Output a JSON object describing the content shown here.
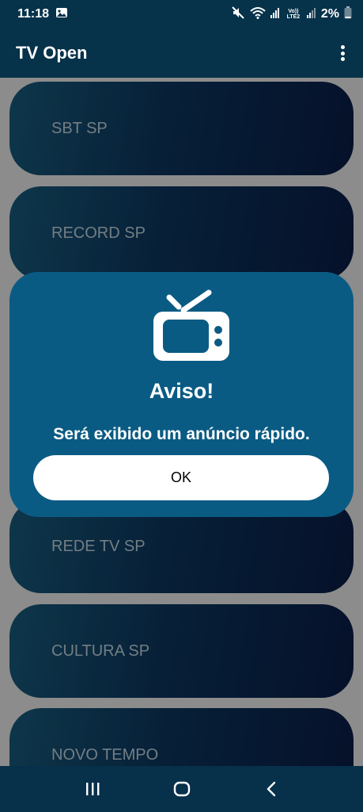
{
  "status_bar": {
    "time": "11:18",
    "lte_label": "Vo)) LTE2",
    "battery_percent": "2%"
  },
  "app_bar": {
    "title": "TV Open"
  },
  "channels": [
    {
      "label": "SBT SP"
    },
    {
      "label": "RECORD SP"
    },
    {
      "label": ""
    },
    {
      "label": ""
    },
    {
      "label": "REDE TV SP"
    },
    {
      "label": "CULTURA SP"
    },
    {
      "label": "NOVO TEMPO"
    }
  ],
  "dialog": {
    "title": "Aviso!",
    "message": "Será exibido um anúncio rápido.",
    "ok_label": "OK"
  },
  "colors": {
    "app_bar": "#06324a",
    "dialog": "#0a5b83",
    "channel_gradient_start": "#1a6488",
    "channel_gradient_end": "#0a1f4c"
  },
  "icons": [
    "gallery-icon",
    "mute-icon",
    "wifi-icon",
    "signal-icon",
    "battery-icon",
    "more-vert-icon",
    "tv-icon",
    "recents-icon",
    "home-icon",
    "back-icon"
  ]
}
